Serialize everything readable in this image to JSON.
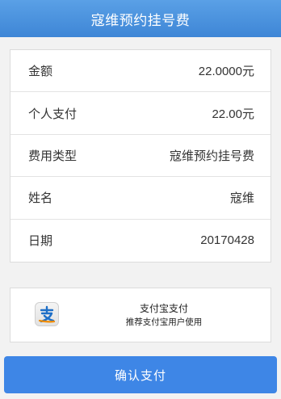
{
  "header": {
    "title": "寇维预约挂号费"
  },
  "details": [
    {
      "label": "金额",
      "value": "22.0000元"
    },
    {
      "label": "个人支付",
      "value": "22.00元"
    },
    {
      "label": "费用类型",
      "value": "寇维预约挂号费"
    },
    {
      "label": "姓名",
      "value": "寇维"
    },
    {
      "label": "日期",
      "value": "20170428"
    }
  ],
  "payment": {
    "icon": "alipay-icon",
    "title": "支付宝支付",
    "subtitle": "推荐支付宝用户使用"
  },
  "confirm": {
    "label": "确认支付"
  },
  "colors": {
    "accent": "#3e86e6",
    "header": "#4a90dc",
    "alipay_orange": "#f08c00",
    "alipay_blue": "#1e6fc7"
  }
}
